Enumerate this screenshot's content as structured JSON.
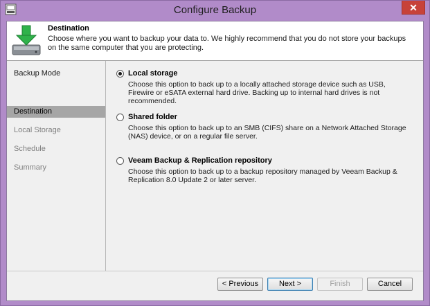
{
  "window": {
    "title": "Configure Backup",
    "close_glyph": "✕"
  },
  "header": {
    "title": "Destination",
    "description": "Choose where you want to backup your data to. We highly recommend that you do not store your backups on the same computer that you are protecting."
  },
  "sidebar": {
    "items": [
      {
        "label": "Backup Mode",
        "state": "done"
      },
      {
        "label": "Destination",
        "state": "active"
      },
      {
        "label": "Local Storage",
        "state": "pending"
      },
      {
        "label": "Schedule",
        "state": "pending"
      },
      {
        "label": "Summary",
        "state": "pending"
      }
    ]
  },
  "options": [
    {
      "label": "Local storage",
      "checked": true,
      "description": "Choose this option to back up to a locally attached storage device such as USB, Firewire or eSATA external hard drive. Backing up to internal hard drives is not recommended."
    },
    {
      "label": "Shared folder",
      "checked": false,
      "description": "Choose this option to back up to an SMB (CIFS) share on a Network Attached Storage (NAS) device, or on a regular file server."
    },
    {
      "label": "Veeam Backup & Replication repository",
      "checked": false,
      "description": "Choose this option to back up to a backup repository managed by Veeam Backup & Replication 8.0 Update 2 or later server."
    }
  ],
  "buttons": {
    "previous": "< Previous",
    "next": "Next >",
    "finish": "Finish",
    "cancel": "Cancel"
  },
  "colors": {
    "window_frame": "#b18bc9",
    "close_button": "#c7423a",
    "active_step": "#a6a6a6",
    "header_icon_arrow": "#2fb24a"
  }
}
